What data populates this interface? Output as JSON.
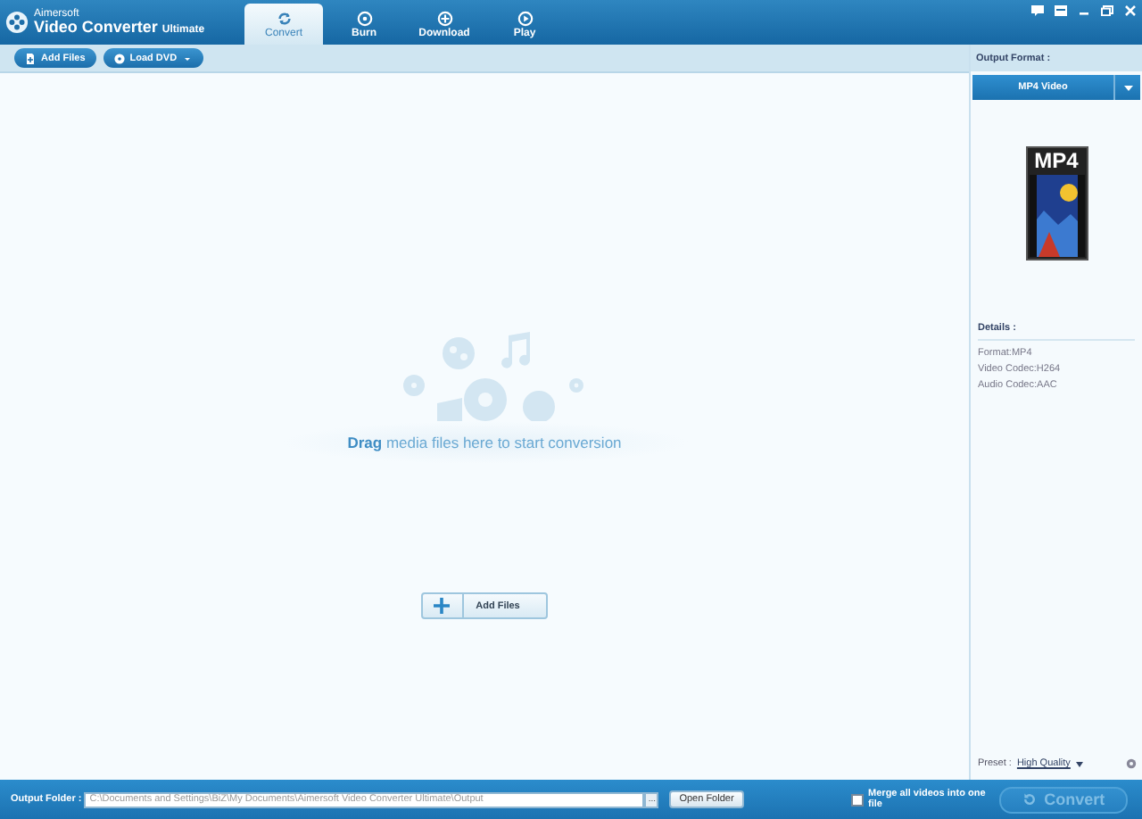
{
  "app": {
    "brand": "Aimersoft",
    "title": "Video Converter",
    "edition": "Ultimate"
  },
  "tabs": [
    {
      "label": "Convert",
      "kind": "convert",
      "selected": true
    },
    {
      "label": "Burn",
      "kind": "burn",
      "selected": false
    },
    {
      "label": "Download",
      "kind": "download",
      "selected": false
    },
    {
      "label": "Play",
      "kind": "play",
      "selected": false
    }
  ],
  "toolbar": {
    "add_files": "Add Files",
    "load_dvd": "Load DVD"
  },
  "drop_zone": {
    "message": "**Drag** media files here to start conversion",
    "add_button": "Add Files"
  },
  "output_format": {
    "label": "Output Format :",
    "value": "MP4 Video",
    "badge": "MP4"
  },
  "details": {
    "heading": "Details :",
    "lines": [
      "Format:MP4",
      "Video Codec:H264",
      "Audio Codec:AAC"
    ]
  },
  "preset": {
    "label": "Preset :",
    "value": "High Quality"
  },
  "footer": {
    "label": "Output Folder :",
    "path": "C:\\Documents and Settings\\BiZ\\My Documents\\Aimersoft Video Converter Ultimate\\Output",
    "browse": "...",
    "open_button": "Open Folder",
    "merge": {
      "label": "Merge all videos into one file",
      "checked": false
    },
    "convert": {
      "label": "Convert",
      "disabled": true
    }
  }
}
